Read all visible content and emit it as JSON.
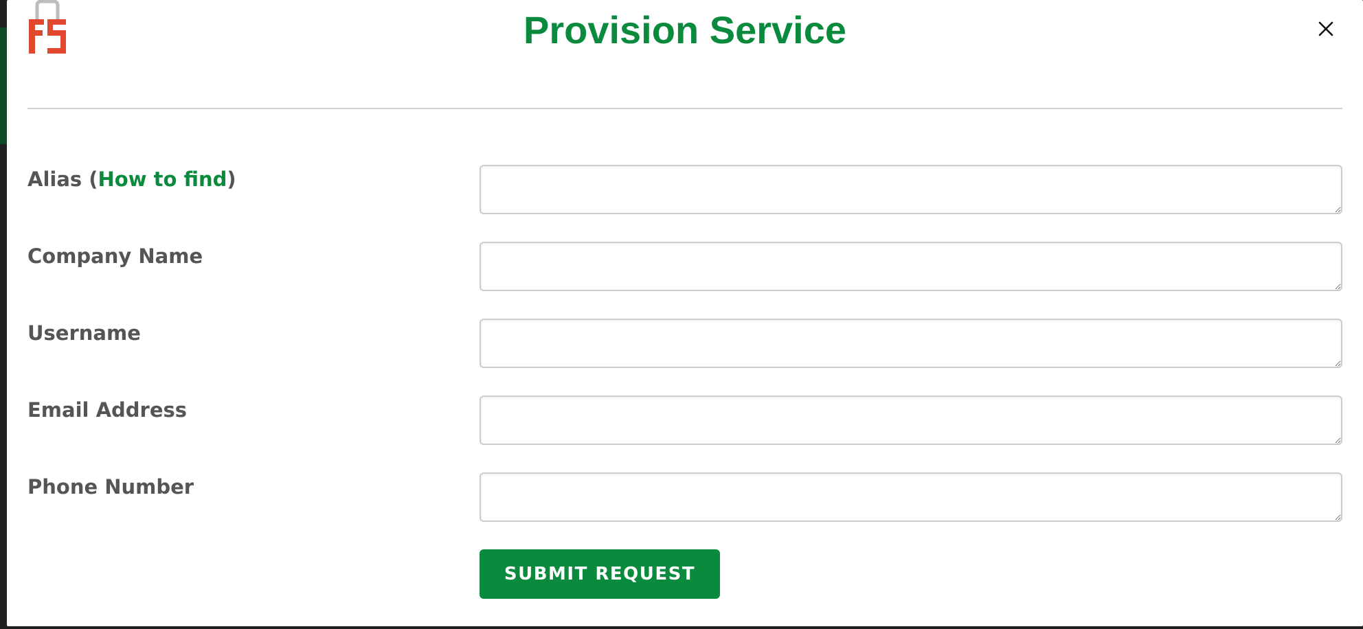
{
  "modal": {
    "title": "Provision Service",
    "logo_text": "FS",
    "close_icon": "close-icon",
    "colors": {
      "accent": "#0a8a3c",
      "logo": "#e2482d",
      "label": "#555555"
    }
  },
  "form": {
    "alias": {
      "label_prefix": "Alias (",
      "help_link": "How to find",
      "label_suffix": ")",
      "value": ""
    },
    "company_name": {
      "label": "Company Name",
      "value": ""
    },
    "username": {
      "label": "Username",
      "value": ""
    },
    "email_address": {
      "label": "Email Address",
      "value": ""
    },
    "phone_number": {
      "label": "Phone Number",
      "value": ""
    },
    "submit_label": "SUBMIT REQUEST"
  }
}
